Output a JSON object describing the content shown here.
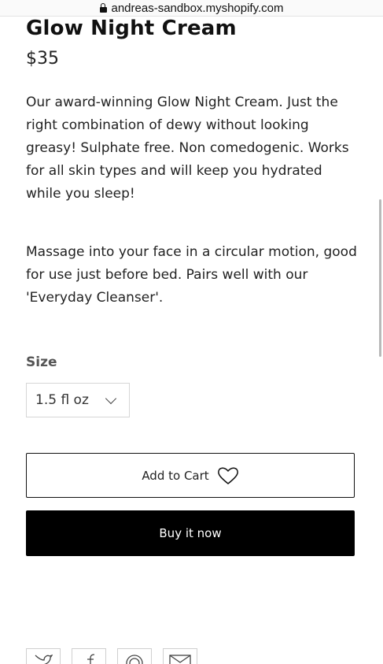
{
  "browser": {
    "url": "andreas-sandbox.myshopify.com",
    "icons": {
      "lock": "lock-icon"
    }
  },
  "product": {
    "title": "Glow Night Cream",
    "price": "$35",
    "description_1": " Our award-winning Glow Night Cream. Just the right combination of dewy without looking greasy! Sulphate free. Non comedogenic. Works for all skin types and will keep you hydrated while you sleep!",
    "description_2": "Massage into your face in a circular motion, good for use just before bed. Pairs well with our 'Everyday Cleanser'.",
    "size_label": "Size",
    "size_selected": "1.5 fl oz"
  },
  "actions": {
    "add_to_cart_label": "Add to Cart",
    "buy_now_label": "Buy it now"
  },
  "share": {
    "icons": [
      "twitter-icon",
      "facebook-icon",
      "pinterest-icon",
      "email-icon"
    ]
  },
  "colors": {
    "text": "#222222",
    "buy_button_bg": "#000000",
    "buy_button_text": "#ffffff",
    "border": "#111111"
  }
}
